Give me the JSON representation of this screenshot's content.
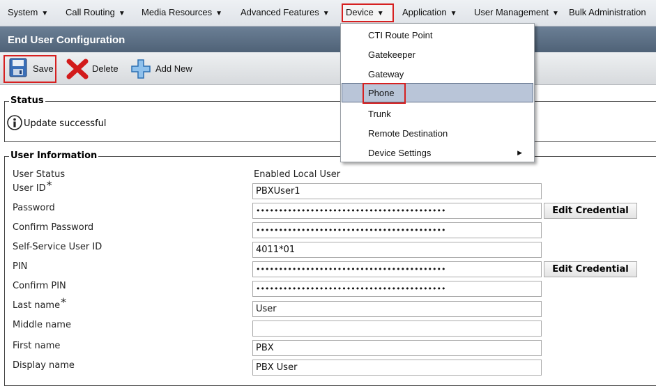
{
  "menu": {
    "items": [
      {
        "label": "System"
      },
      {
        "label": "Call Routing"
      },
      {
        "label": "Media Resources"
      },
      {
        "label": "Advanced Features"
      },
      {
        "label": "Device"
      },
      {
        "label": "Application"
      },
      {
        "label": "User Management"
      },
      {
        "label": "Bulk Administration"
      }
    ],
    "open_menu": "Device",
    "dropdown": [
      {
        "label": "CTI Route Point"
      },
      {
        "label": "Gatekeeper"
      },
      {
        "label": "Gateway"
      },
      {
        "label": "Phone",
        "highlighted": true
      },
      {
        "label": "Trunk"
      },
      {
        "label": "Remote Destination"
      },
      {
        "label": "Device Settings",
        "has_submenu": true
      }
    ]
  },
  "page": {
    "title": "End User Configuration"
  },
  "toolbar": {
    "save_label": "Save",
    "delete_label": "Delete",
    "add_new_label": "Add New",
    "icons": [
      "floppy-disk-icon",
      "red-x-icon",
      "blue-plus-icon"
    ]
  },
  "status": {
    "legend": "Status",
    "message": "Update successful",
    "icon": "info-icon"
  },
  "user_info": {
    "legend": "User Information",
    "fields": [
      {
        "label": "User Status",
        "value": "Enabled Local User"
      },
      {
        "label": "User ID",
        "value": "PBXUser1",
        "required_mark": "*"
      },
      {
        "label": "Password",
        "value": "••••••••••••••••••••••••••••••••••••••••••",
        "button": "Edit Credential"
      },
      {
        "label": "Confirm Password",
        "value": "••••••••••••••••••••••••••••••••••••••••••"
      },
      {
        "label": "Self-Service User ID",
        "value": "4011*01"
      },
      {
        "label": "PIN",
        "value": "••••••••••••••••••••••••••••••••••••••••••",
        "button": "Edit Credential"
      },
      {
        "label": "Confirm PIN",
        "value": "••••••••••••••••••••••••••••••••••••••••••"
      },
      {
        "label": "Last name",
        "value": "User",
        "required_mark": "*"
      },
      {
        "label": "Middle name",
        "value": ""
      },
      {
        "label": "First name",
        "value": "PBX"
      },
      {
        "label": "Display name",
        "value": "PBX User"
      }
    ]
  },
  "colors": {
    "highlight_border": "#d62020",
    "title_bar": "#5c6f85",
    "menu_active": "#b9c5d8"
  }
}
